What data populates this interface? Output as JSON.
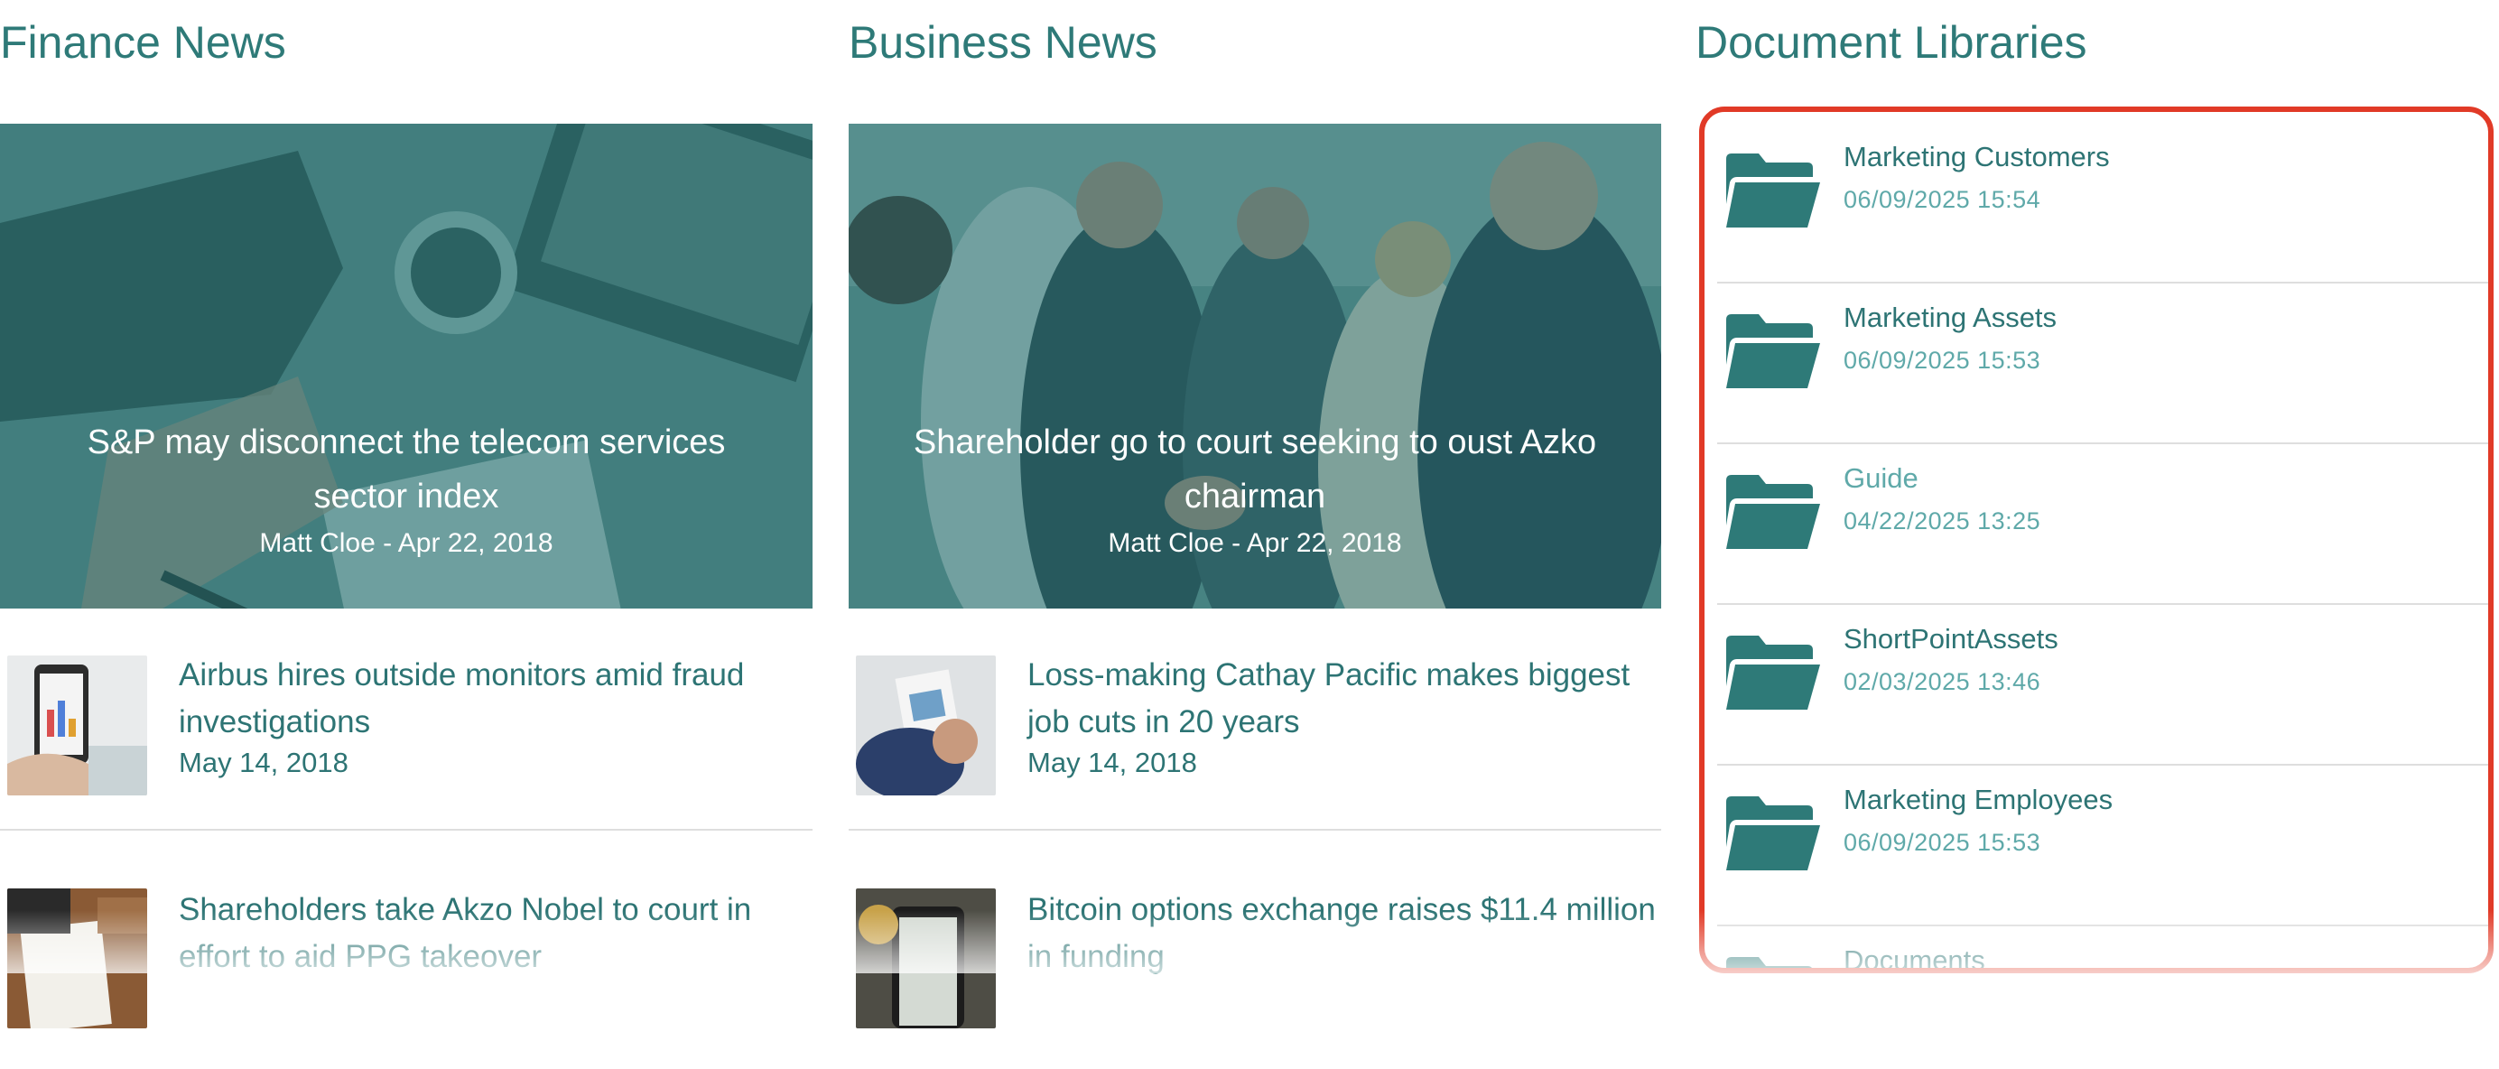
{
  "finance": {
    "title": "Finance News",
    "hero": {
      "title": "S&P may disconnect the telecom services sector index",
      "meta": "Matt Cloe - Apr 22, 2018"
    },
    "items": [
      {
        "title": "Airbus hires outside monitors amid fraud investigations",
        "date": "May 14, 2018"
      },
      {
        "title": "Shareholders take Akzo Nobel to court in effort to aid PPG takeover",
        "date": ""
      }
    ]
  },
  "business": {
    "title": "Business News",
    "hero": {
      "title": "Shareholder go to court seeking to oust Azko chairman",
      "meta": "Matt Cloe - Apr 22, 2018"
    },
    "items": [
      {
        "title": "Loss-making Cathay Pacific makes biggest job cuts in 20 years",
        "date": "May 14, 2018"
      },
      {
        "title": "Bitcoin options exchange raises $11.4 million in funding",
        "date": ""
      }
    ]
  },
  "docs": {
    "title": "Document Libraries",
    "items": [
      {
        "name": "Marketing Customers",
        "date": "06/09/2025 15:54"
      },
      {
        "name": "Marketing Assets",
        "date": "06/09/2025 15:53"
      },
      {
        "name": "Guide",
        "date": "04/22/2025 13:25"
      },
      {
        "name": "ShortPointAssets",
        "date": "02/03/2025 13:46"
      },
      {
        "name": "Marketing Employees",
        "date": "06/09/2025 15:53"
      },
      {
        "name": "Documents",
        "date": ""
      }
    ]
  },
  "colors": {
    "accent": "#2e7a78",
    "accent_light": "#5fa9a9",
    "highlight_border": "#e13a27",
    "overlay": "#2a7373"
  },
  "icons": {
    "folder": "folder-open-icon"
  }
}
